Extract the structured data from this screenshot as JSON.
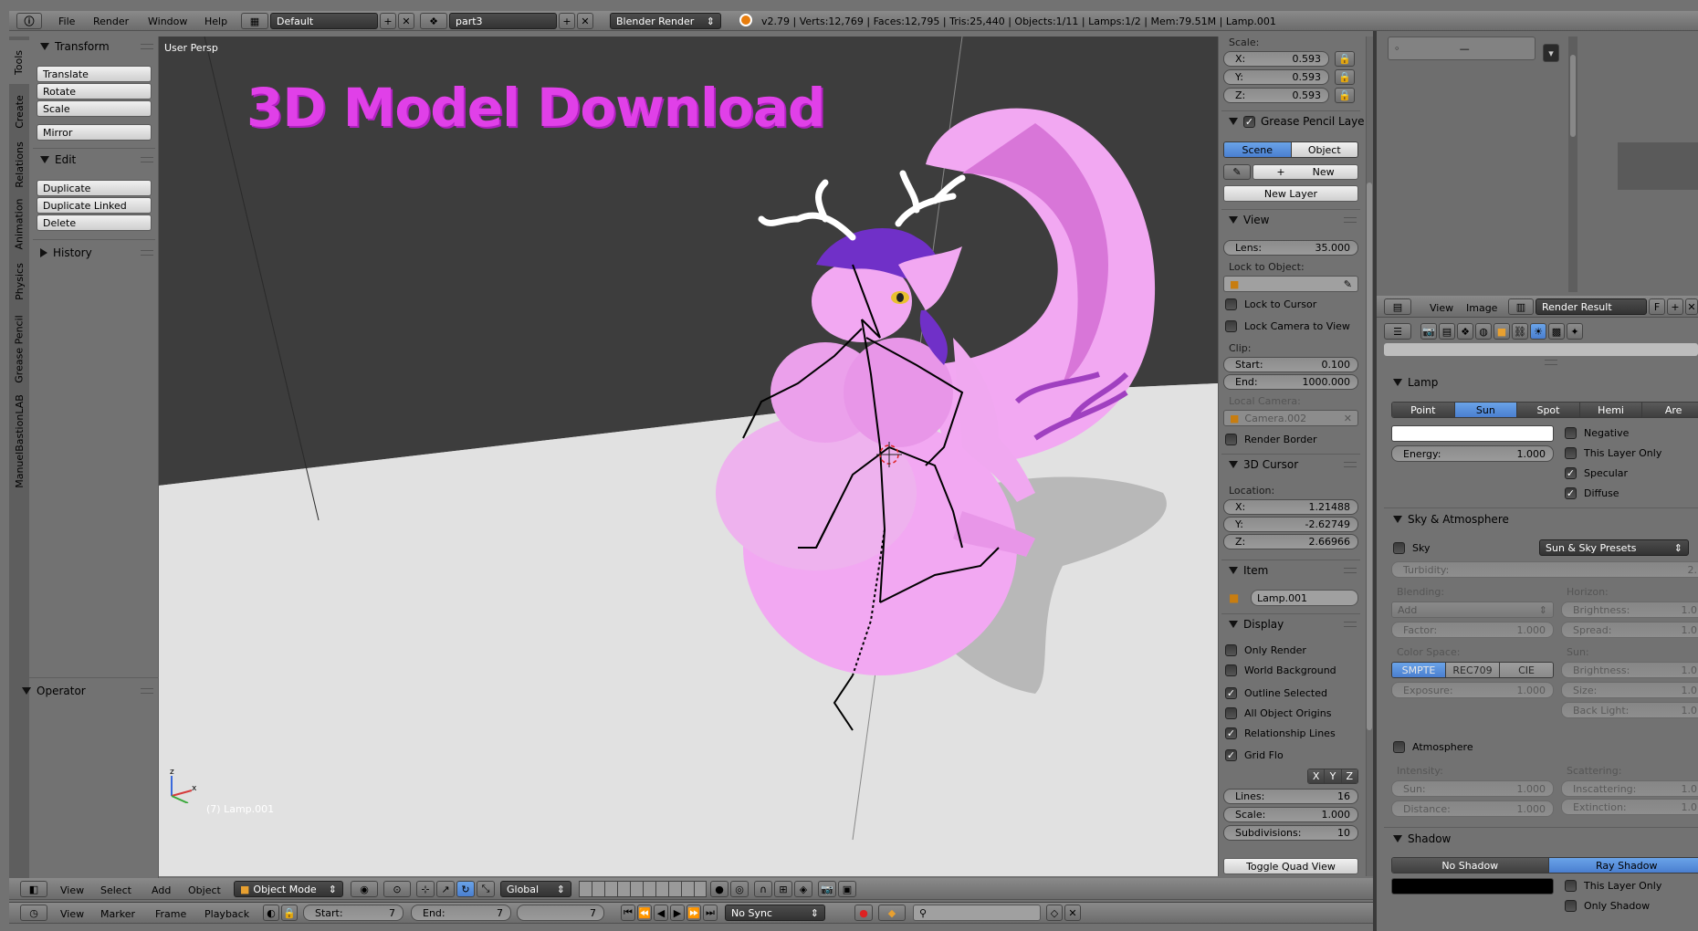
{
  "topbar": {
    "info_icon": "info-icon",
    "menu": [
      "File",
      "Render",
      "Window",
      "Help"
    ],
    "screen_layout": "Default",
    "scene": "part3",
    "render_engine": "Blender Render",
    "stats": "v2.79 | Verts:12,769 | Faces:12,795 | Tris:25,440 | Objects:1/11 | Lamps:1/2 | Mem:79.51M | Lamp.001"
  },
  "tool_tabs": [
    "Tools",
    "Create",
    "Relations",
    "Animation",
    "Physics",
    "Grease Pencil",
    "ManuelBastionLAB"
  ],
  "toolshelf": {
    "transform_title": "Transform",
    "translate": "Translate",
    "rotate": "Rotate",
    "scale": "Scale",
    "mirror": "Mirror",
    "edit_title": "Edit",
    "duplicate": "Duplicate",
    "duplicate_linked": "Duplicate Linked",
    "delete": "Delete",
    "history_title": "History",
    "operator_title": "Operator"
  },
  "viewport": {
    "view_label": "User Persp",
    "overlay_text": "3D Model Download",
    "object_label": "(7) Lamp.001",
    "overlay_color": "#e040e8",
    "character_color": "#f2a8f2"
  },
  "properties_n": {
    "scale_label": "Scale:",
    "scale": [
      {
        "axis": "X:",
        "value": "0.593"
      },
      {
        "axis": "Y:",
        "value": "0.593"
      },
      {
        "axis": "Z:",
        "value": "0.593"
      }
    ],
    "grease_title": "Grease Pencil Laye",
    "scene_tab": "Scene",
    "object_tab": "Object",
    "new_label": "New",
    "new_layer": "New Layer",
    "view_title": "View",
    "lens_label": "Lens:",
    "lens_value": "35.000",
    "lock_to_object": "Lock to Object:",
    "lock_to_cursor": "Lock to Cursor",
    "lock_camera": "Lock Camera to View",
    "clip_label": "Clip:",
    "clip_start_label": "Start:",
    "clip_start": "0.100",
    "clip_end_label": "End:",
    "clip_end": "1000.000",
    "local_camera": "Local Camera:",
    "camera_name": "Camera.002",
    "render_border": "Render Border",
    "cursor_title": "3D Cursor",
    "location_label": "Location:",
    "cursor": [
      {
        "axis": "X:",
        "value": "1.21488"
      },
      {
        "axis": "Y:",
        "value": "-2.62749"
      },
      {
        "axis": "Z:",
        "value": "2.66966"
      }
    ],
    "item_title": "Item",
    "item_name": "Lamp.001",
    "display_title": "Display",
    "display_opts": [
      {
        "label": "Only Render",
        "checked": false
      },
      {
        "label": "World Background",
        "checked": false
      },
      {
        "label": "Outline Selected",
        "checked": true
      },
      {
        "label": "All Object Origins",
        "checked": false
      },
      {
        "label": "Relationship Lines",
        "checked": true
      }
    ],
    "grid_floor": "Grid Flo",
    "axes": [
      "X",
      "Y",
      "Z"
    ],
    "lines_label": "Lines:",
    "lines_value": "16",
    "grid_scale_label": "Scale:",
    "grid_scale_value": "1.000",
    "subdiv_label": "Subdivisions:",
    "subdiv_value": "10",
    "toggle_quad": "Toggle Quad View"
  },
  "viewport_header": {
    "menu": [
      "View",
      "Select",
      "Add",
      "Object"
    ],
    "mode": "Object Mode",
    "orientation": "Global"
  },
  "timeline": {
    "menu": [
      "View",
      "Marker",
      "Frame",
      "Playback"
    ],
    "start_label": "Start:",
    "start_value": "7",
    "end_label": "End:",
    "end_value": "7",
    "current_frame": "7",
    "sync": "No Sync"
  },
  "image_editor": {
    "menu": [
      "View",
      "Image"
    ],
    "image_name": "Render Result",
    "fake_user": "F"
  },
  "lamp_props": {
    "lamp_title": "Lamp",
    "lamp_types": [
      "Point",
      "Sun",
      "Spot",
      "Hemi",
      "Are"
    ],
    "active_type": "Sun",
    "energy_label": "Energy:",
    "energy_value": "1.000",
    "negative": "Negative",
    "this_layer_only": "This Layer Only",
    "specular": "Specular",
    "diffuse": "Diffuse",
    "sky_title": "Sky & Atmosphere",
    "sky": "Sky",
    "sky_presets": "Sun & Sky Presets",
    "turbidity_label": "Turbidity:",
    "turbidity_value": "2.",
    "blending_label": "Blending:",
    "blend_mode": "Add",
    "factor_label": "Factor:",
    "factor_value": "1.000",
    "horizon_label": "Horizon:",
    "brightness_label": "Brightness:",
    "brightness_value": "1.0",
    "spread_label": "Spread:",
    "spread_value": "1.0",
    "color_space_label": "Color Space:",
    "color_spaces": [
      "SMPTE",
      "REC709",
      "CIE"
    ],
    "exposure_label": "Exposure:",
    "exposure_value": "1.000",
    "sun_label": "Sun:",
    "sun_brightness_label": "Brightness:",
    "sun_brightness_value": "1.0",
    "size_label": "Size:",
    "size_value": "1.0",
    "back_light_label": "Back Light:",
    "back_light_value": "1.0",
    "atmosphere": "Atmosphere",
    "intensity_label": "Intensity:",
    "scattering_label": "Scattering:",
    "int_sun_label": "Sun:",
    "int_sun_value": "1.000",
    "distance_label": "Distance:",
    "distance_value": "1.000",
    "inscattering_label": "Inscattering:",
    "inscattering_value": "1.0",
    "extinction_label": "Extinction:",
    "extinction_value": "1.0",
    "shadow_title": "Shadow",
    "no_shadow": "No Shadow",
    "ray_shadow": "Ray Shadow",
    "shadow_layer_only": "This Layer Only",
    "only_shadow": "Only Shadow"
  }
}
